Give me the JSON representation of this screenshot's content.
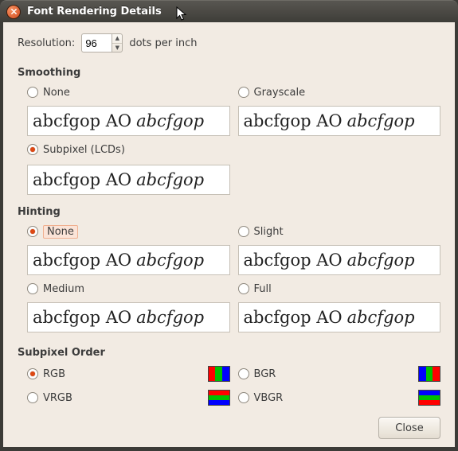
{
  "window": {
    "title": "Font Rendering Details"
  },
  "resolution": {
    "label": "Resolution:",
    "value": "96",
    "units": "dots per inch"
  },
  "sample": {
    "regular": "abcfgop AO",
    "italic": "abcfgop"
  },
  "smoothing": {
    "heading": "Smoothing",
    "none": "None",
    "grayscale": "Grayscale",
    "subpixel": "Subpixel (LCDs)",
    "selected": "subpixel"
  },
  "hinting": {
    "heading": "Hinting",
    "none": "None",
    "slight": "Slight",
    "medium": "Medium",
    "full": "Full",
    "selected": "none"
  },
  "subpixel_order": {
    "heading": "Subpixel Order",
    "rgb": "RGB",
    "bgr": "BGR",
    "vrgb": "VRGB",
    "vbgr": "VBGR",
    "selected": "rgb"
  },
  "colors": {
    "r": "#ff0000",
    "g": "#00c000",
    "b": "#0000ff"
  },
  "footer": {
    "close": "Close"
  }
}
